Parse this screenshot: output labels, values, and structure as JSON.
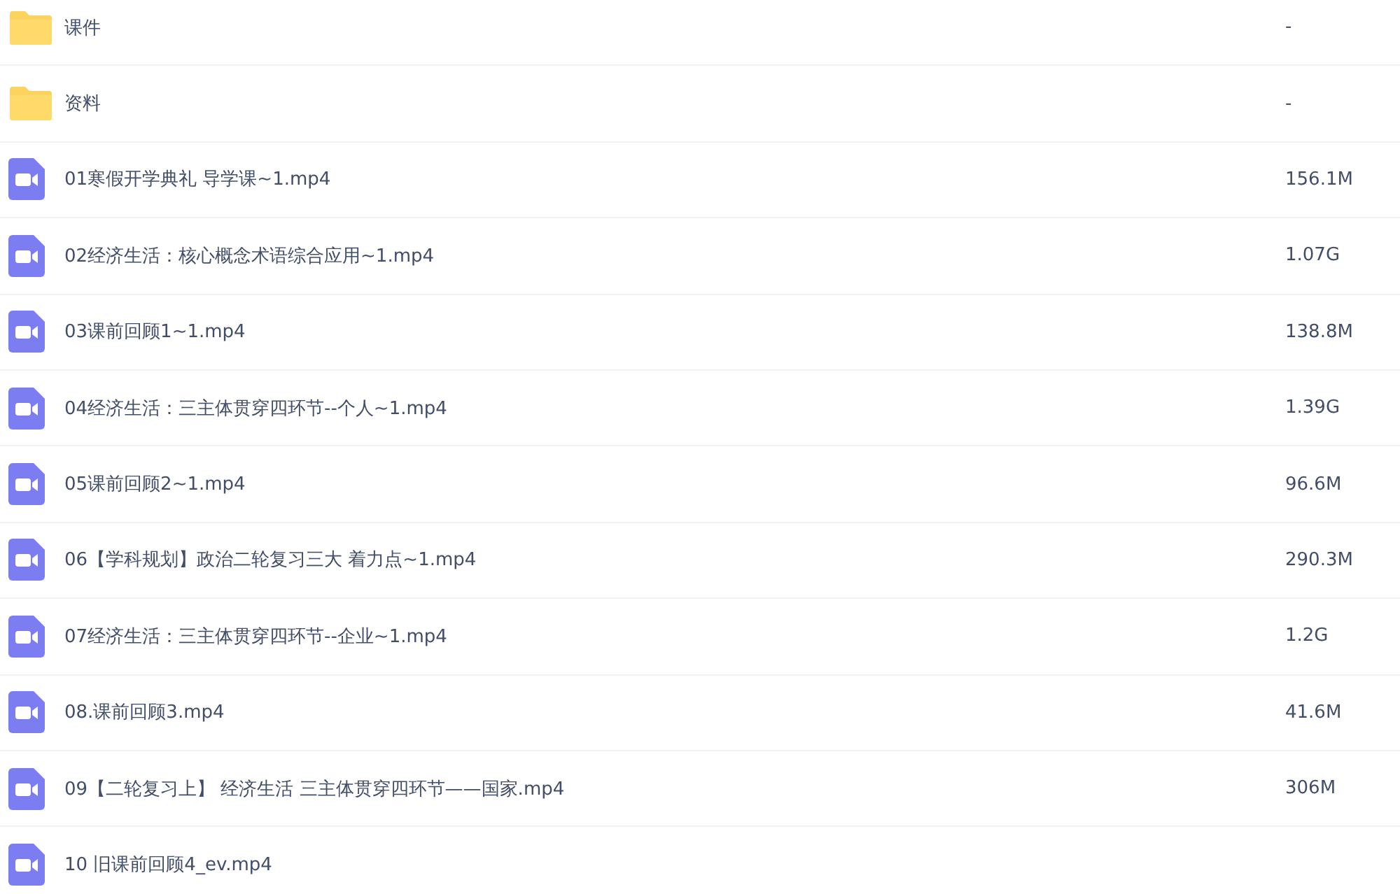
{
  "files": [
    {
      "kind": "folder",
      "name": "课件",
      "size": "-"
    },
    {
      "kind": "folder",
      "name": "资料",
      "size": "-"
    },
    {
      "kind": "video",
      "name": "01寒假开学典礼 导学课~1.mp4",
      "size": "156.1M"
    },
    {
      "kind": "video",
      "name": "02经济生活：核心概念术语综合应用~1.mp4",
      "size": "1.07G"
    },
    {
      "kind": "video",
      "name": "03课前回顾1~1.mp4",
      "size": "138.8M"
    },
    {
      "kind": "video",
      "name": "04经济生活：三主体贯穿四环节--个人~1.mp4",
      "size": "1.39G"
    },
    {
      "kind": "video",
      "name": "05课前回顾2~1.mp4",
      "size": "96.6M"
    },
    {
      "kind": "video",
      "name": "06【学科规划】政治二轮复习三大 着力点~1.mp4",
      "size": "290.3M"
    },
    {
      "kind": "video",
      "name": "07经济生活：三主体贯穿四环节--企业~1.mp4",
      "size": "1.2G"
    },
    {
      "kind": "video",
      "name": "08.课前回顾3.mp4",
      "size": "41.6M"
    },
    {
      "kind": "video",
      "name": "09【二轮复习上】 经济生活 三主体贯穿四环节——国家.mp4",
      "size": "306M"
    },
    {
      "kind": "video",
      "name": "10 旧课前回顾4_ev.mp4"
    }
  ]
}
